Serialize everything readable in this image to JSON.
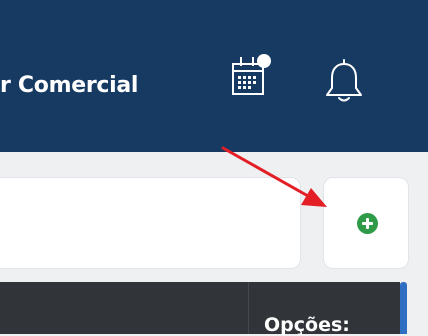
{
  "header": {
    "title": "r Comercial",
    "background_color": "#173a63",
    "icons": [
      "calendar-icon",
      "bell-icon"
    ]
  },
  "toolbar": {
    "add_button_icon": "plus-circle-icon",
    "add_button_color": "#2f9b48"
  },
  "annotation": {
    "arrow_color": "#e31e24"
  },
  "table": {
    "columns": [
      "Opções:"
    ],
    "header_background": "#313438"
  }
}
